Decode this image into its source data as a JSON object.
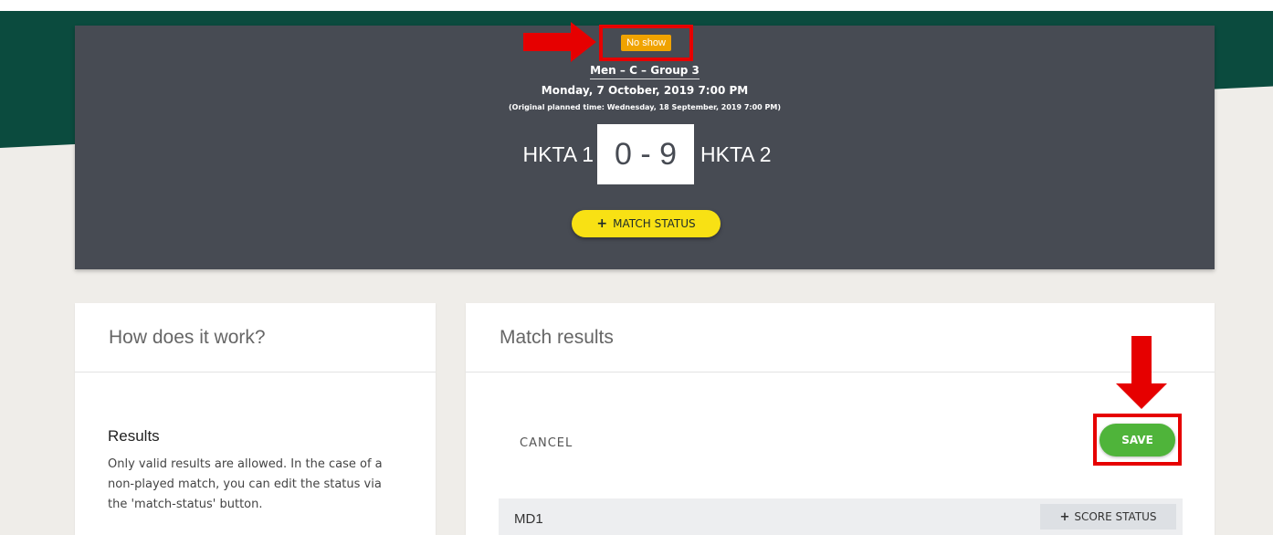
{
  "header": {
    "status_badge": "No show",
    "group": "Men – C – Group 3",
    "date": "Monday, 7 October, 2019 7:00 PM",
    "original_time": "(Original planned time: Wednesday, 18 September, 2019 7:00 PM)",
    "team_home": "HKTA 1",
    "team_away": "HKTA 2",
    "score": "0 - 9",
    "match_status_label": "MATCH STATUS",
    "plus_icon": "+"
  },
  "how_it_works": {
    "title": "How does it work?",
    "results_heading": "Results",
    "results_text": "Only valid results are allowed. In the case of a non-played match, you can edit the status via the 'match-status' button."
  },
  "match_results": {
    "title": "Match results",
    "cancel_label": "CANCEL",
    "save_label": "SAVE",
    "row_label": "MD1",
    "score_status_label": "SCORE STATUS",
    "plus_icon": "+"
  },
  "colors": {
    "brand_green": "#0b4b3e",
    "hero_bg": "#474b53",
    "badge_orange": "#f0a300",
    "match_status_yellow": "#f8e114",
    "save_green": "#4fb43a",
    "highlight_red": "#e60000"
  }
}
